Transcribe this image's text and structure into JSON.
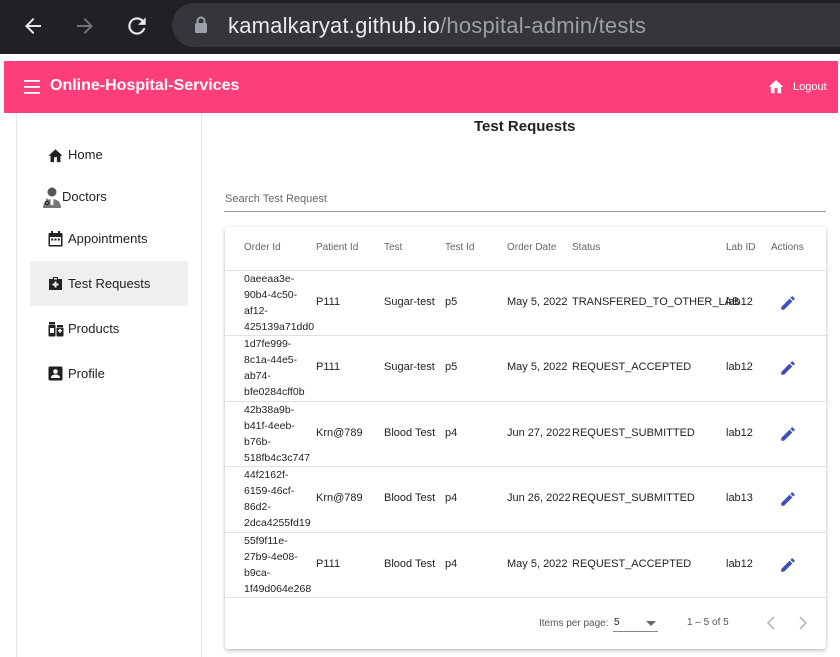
{
  "browser": {
    "url_host": "kamalkaryat.github.io",
    "url_path": "/hospital-admin/tests"
  },
  "header": {
    "title": "Online-Hospital-Services",
    "logout_label": "Logout",
    "color": "#fe3e7b"
  },
  "sidebar": {
    "items": [
      {
        "label": "Home",
        "icon": "home-icon"
      },
      {
        "label": "Doctors",
        "icon": "doctor-icon"
      },
      {
        "label": "Appointments",
        "icon": "calendar-icon"
      },
      {
        "label": "Test Requests",
        "icon": "medical-kit-icon",
        "active": true
      },
      {
        "label": "Products",
        "icon": "products-icon"
      },
      {
        "label": "Profile",
        "icon": "profile-icon"
      }
    ]
  },
  "main": {
    "title": "Test Requests",
    "search_placeholder": "Search Test Request"
  },
  "table": {
    "columns": [
      "Order Id",
      "Patient Id",
      "Test",
      "Test Id",
      "Order Date",
      "Status",
      "Lab ID",
      "Actions"
    ],
    "rows": [
      {
        "order_lines": [
          "0aeeaa3e-",
          "90b4-4c50-",
          "af12-",
          "425139a71dd0"
        ],
        "patient": "P111",
        "test": "Sugar-test",
        "test_id": "p5",
        "date": "May 5, 2022",
        "status": "TRANSFERED_TO_OTHER_LAB",
        "lab": "lab12"
      },
      {
        "order_lines": [
          "1d7fe999-",
          "8c1a-44e5-",
          "ab74-",
          "bfe0284cff0b"
        ],
        "patient": "P111",
        "test": "Sugar-test",
        "test_id": "p5",
        "date": "May 5, 2022",
        "status": "REQUEST_ACCEPTED",
        "lab": "lab12"
      },
      {
        "order_lines": [
          "42b38a9b-",
          "b41f-4eeb-",
          "b76b-",
          "518fb4c3c747"
        ],
        "patient": "Krn@789",
        "test": "Blood Test",
        "test_id": "p4",
        "date": "Jun 27, 2022",
        "status": "REQUEST_SUBMITTED",
        "lab": "lab12"
      },
      {
        "order_lines": [
          "44f2162f-",
          "6159-46cf-",
          "86d2-",
          "2dca4255fd19"
        ],
        "patient": "Krn@789",
        "test": "Blood Test",
        "test_id": "p4",
        "date": "Jun 26, 2022",
        "status": "REQUEST_SUBMITTED",
        "lab": "lab13"
      },
      {
        "order_lines": [
          "55f9f11e-",
          "27b9-4e08-",
          "b9ca-",
          "1f49d064e268"
        ],
        "patient": "P111",
        "test": "Blood Test",
        "test_id": "p4",
        "date": "May 5, 2022",
        "status": "REQUEST_ACCEPTED",
        "lab": "lab12"
      }
    ]
  },
  "paginator": {
    "items_per_page_label": "Items per page:",
    "items_per_page_value": "5",
    "range_label": "1 – 5 of 5"
  },
  "colors": {
    "accent": "#fe3e7b",
    "edit_icon": "#3f51b5"
  }
}
